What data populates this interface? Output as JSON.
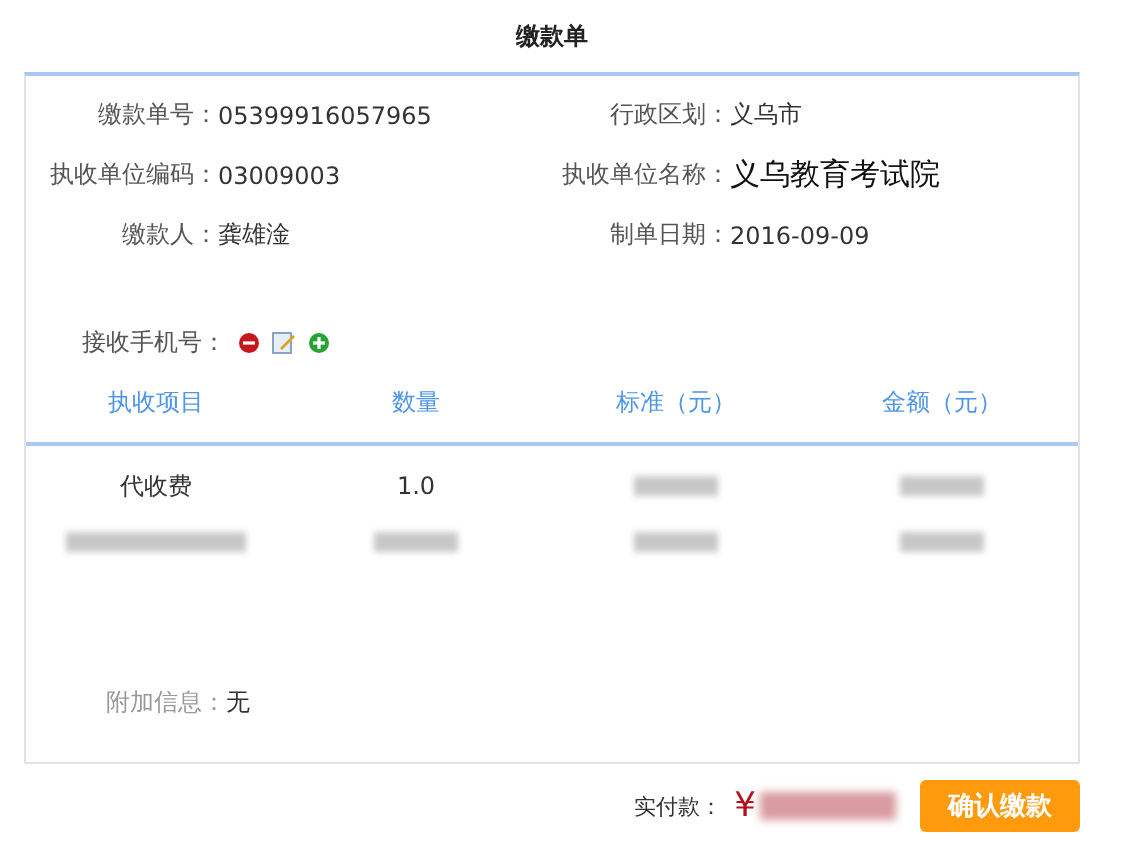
{
  "title": "缴款单",
  "fields": [
    {
      "label": "缴款单号：",
      "value": "05399916057965",
      "emphasis": false
    },
    {
      "label": "行政区划：",
      "value": "义乌市",
      "emphasis": false
    },
    {
      "label": "执收单位编码：",
      "value": "03009003",
      "emphasis": false
    },
    {
      "label": "执收单位名称：",
      "value": "义乌教育考试院",
      "emphasis": true
    },
    {
      "label": "缴款人：",
      "value": "龚雄淦",
      "emphasis": false
    },
    {
      "label": "制单日期：",
      "value": "2016-09-09",
      "emphasis": false
    }
  ],
  "phone": {
    "label": "接收手机号："
  },
  "table": {
    "columns": [
      "执收项目",
      "数量",
      "标准（元）",
      "金额（元）"
    ],
    "rows": [
      {
        "cells": [
          {
            "kind": "text",
            "text": "代收费"
          },
          {
            "kind": "text",
            "text": "1.0"
          },
          {
            "kind": "redacted"
          },
          {
            "kind": "redacted"
          }
        ]
      },
      {
        "cells": [
          {
            "kind": "redacted"
          },
          {
            "kind": "redacted"
          },
          {
            "kind": "redacted"
          },
          {
            "kind": "redacted"
          }
        ]
      }
    ]
  },
  "extra": {
    "label": "附加信息：",
    "value": "无"
  },
  "footer": {
    "label": "实付款：",
    "currency": "¥",
    "button": "确认缴款"
  }
}
